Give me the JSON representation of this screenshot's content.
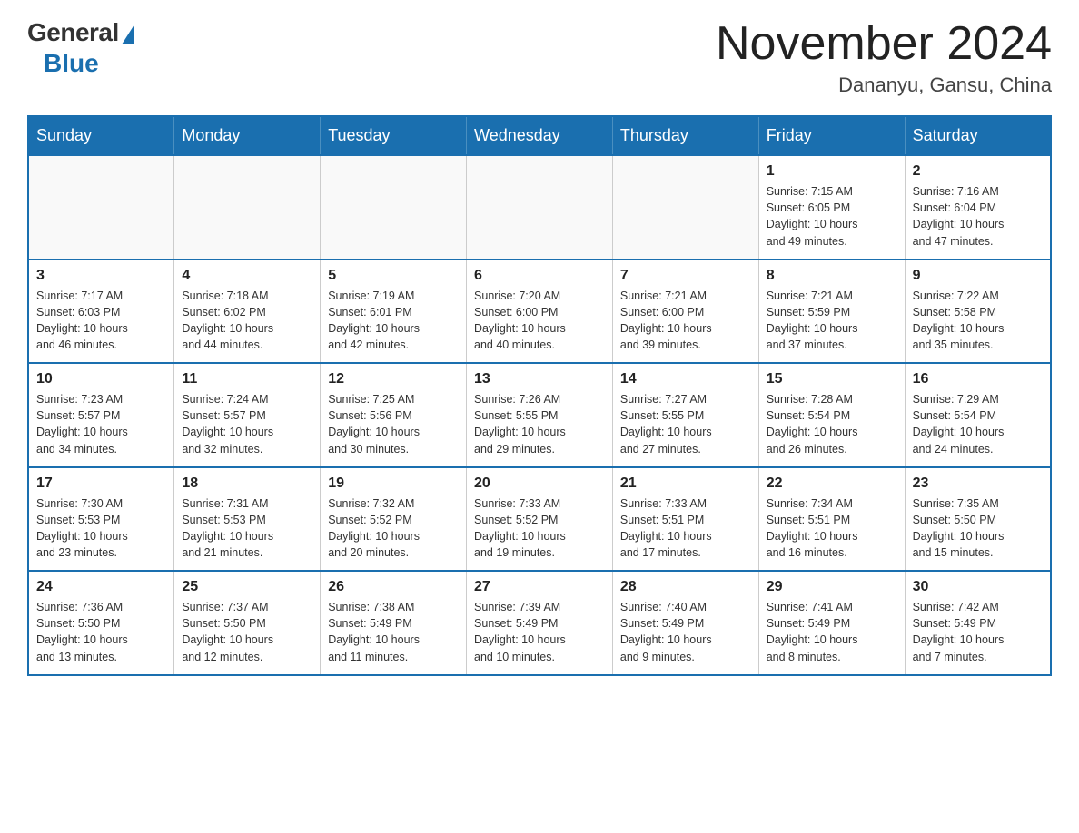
{
  "logo": {
    "general": "General",
    "blue": "Blue"
  },
  "header": {
    "month_year": "November 2024",
    "location": "Dananyu, Gansu, China"
  },
  "weekdays": [
    "Sunday",
    "Monday",
    "Tuesday",
    "Wednesday",
    "Thursday",
    "Friday",
    "Saturday"
  ],
  "weeks": [
    [
      {
        "day": "",
        "info": ""
      },
      {
        "day": "",
        "info": ""
      },
      {
        "day": "",
        "info": ""
      },
      {
        "day": "",
        "info": ""
      },
      {
        "day": "",
        "info": ""
      },
      {
        "day": "1",
        "info": "Sunrise: 7:15 AM\nSunset: 6:05 PM\nDaylight: 10 hours\nand 49 minutes."
      },
      {
        "day": "2",
        "info": "Sunrise: 7:16 AM\nSunset: 6:04 PM\nDaylight: 10 hours\nand 47 minutes."
      }
    ],
    [
      {
        "day": "3",
        "info": "Sunrise: 7:17 AM\nSunset: 6:03 PM\nDaylight: 10 hours\nand 46 minutes."
      },
      {
        "day": "4",
        "info": "Sunrise: 7:18 AM\nSunset: 6:02 PM\nDaylight: 10 hours\nand 44 minutes."
      },
      {
        "day": "5",
        "info": "Sunrise: 7:19 AM\nSunset: 6:01 PM\nDaylight: 10 hours\nand 42 minutes."
      },
      {
        "day": "6",
        "info": "Sunrise: 7:20 AM\nSunset: 6:00 PM\nDaylight: 10 hours\nand 40 minutes."
      },
      {
        "day": "7",
        "info": "Sunrise: 7:21 AM\nSunset: 6:00 PM\nDaylight: 10 hours\nand 39 minutes."
      },
      {
        "day": "8",
        "info": "Sunrise: 7:21 AM\nSunset: 5:59 PM\nDaylight: 10 hours\nand 37 minutes."
      },
      {
        "day": "9",
        "info": "Sunrise: 7:22 AM\nSunset: 5:58 PM\nDaylight: 10 hours\nand 35 minutes."
      }
    ],
    [
      {
        "day": "10",
        "info": "Sunrise: 7:23 AM\nSunset: 5:57 PM\nDaylight: 10 hours\nand 34 minutes."
      },
      {
        "day": "11",
        "info": "Sunrise: 7:24 AM\nSunset: 5:57 PM\nDaylight: 10 hours\nand 32 minutes."
      },
      {
        "day": "12",
        "info": "Sunrise: 7:25 AM\nSunset: 5:56 PM\nDaylight: 10 hours\nand 30 minutes."
      },
      {
        "day": "13",
        "info": "Sunrise: 7:26 AM\nSunset: 5:55 PM\nDaylight: 10 hours\nand 29 minutes."
      },
      {
        "day": "14",
        "info": "Sunrise: 7:27 AM\nSunset: 5:55 PM\nDaylight: 10 hours\nand 27 minutes."
      },
      {
        "day": "15",
        "info": "Sunrise: 7:28 AM\nSunset: 5:54 PM\nDaylight: 10 hours\nand 26 minutes."
      },
      {
        "day": "16",
        "info": "Sunrise: 7:29 AM\nSunset: 5:54 PM\nDaylight: 10 hours\nand 24 minutes."
      }
    ],
    [
      {
        "day": "17",
        "info": "Sunrise: 7:30 AM\nSunset: 5:53 PM\nDaylight: 10 hours\nand 23 minutes."
      },
      {
        "day": "18",
        "info": "Sunrise: 7:31 AM\nSunset: 5:53 PM\nDaylight: 10 hours\nand 21 minutes."
      },
      {
        "day": "19",
        "info": "Sunrise: 7:32 AM\nSunset: 5:52 PM\nDaylight: 10 hours\nand 20 minutes."
      },
      {
        "day": "20",
        "info": "Sunrise: 7:33 AM\nSunset: 5:52 PM\nDaylight: 10 hours\nand 19 minutes."
      },
      {
        "day": "21",
        "info": "Sunrise: 7:33 AM\nSunset: 5:51 PM\nDaylight: 10 hours\nand 17 minutes."
      },
      {
        "day": "22",
        "info": "Sunrise: 7:34 AM\nSunset: 5:51 PM\nDaylight: 10 hours\nand 16 minutes."
      },
      {
        "day": "23",
        "info": "Sunrise: 7:35 AM\nSunset: 5:50 PM\nDaylight: 10 hours\nand 15 minutes."
      }
    ],
    [
      {
        "day": "24",
        "info": "Sunrise: 7:36 AM\nSunset: 5:50 PM\nDaylight: 10 hours\nand 13 minutes."
      },
      {
        "day": "25",
        "info": "Sunrise: 7:37 AM\nSunset: 5:50 PM\nDaylight: 10 hours\nand 12 minutes."
      },
      {
        "day": "26",
        "info": "Sunrise: 7:38 AM\nSunset: 5:49 PM\nDaylight: 10 hours\nand 11 minutes."
      },
      {
        "day": "27",
        "info": "Sunrise: 7:39 AM\nSunset: 5:49 PM\nDaylight: 10 hours\nand 10 minutes."
      },
      {
        "day": "28",
        "info": "Sunrise: 7:40 AM\nSunset: 5:49 PM\nDaylight: 10 hours\nand 9 minutes."
      },
      {
        "day": "29",
        "info": "Sunrise: 7:41 AM\nSunset: 5:49 PM\nDaylight: 10 hours\nand 8 minutes."
      },
      {
        "day": "30",
        "info": "Sunrise: 7:42 AM\nSunset: 5:49 PM\nDaylight: 10 hours\nand 7 minutes."
      }
    ]
  ]
}
